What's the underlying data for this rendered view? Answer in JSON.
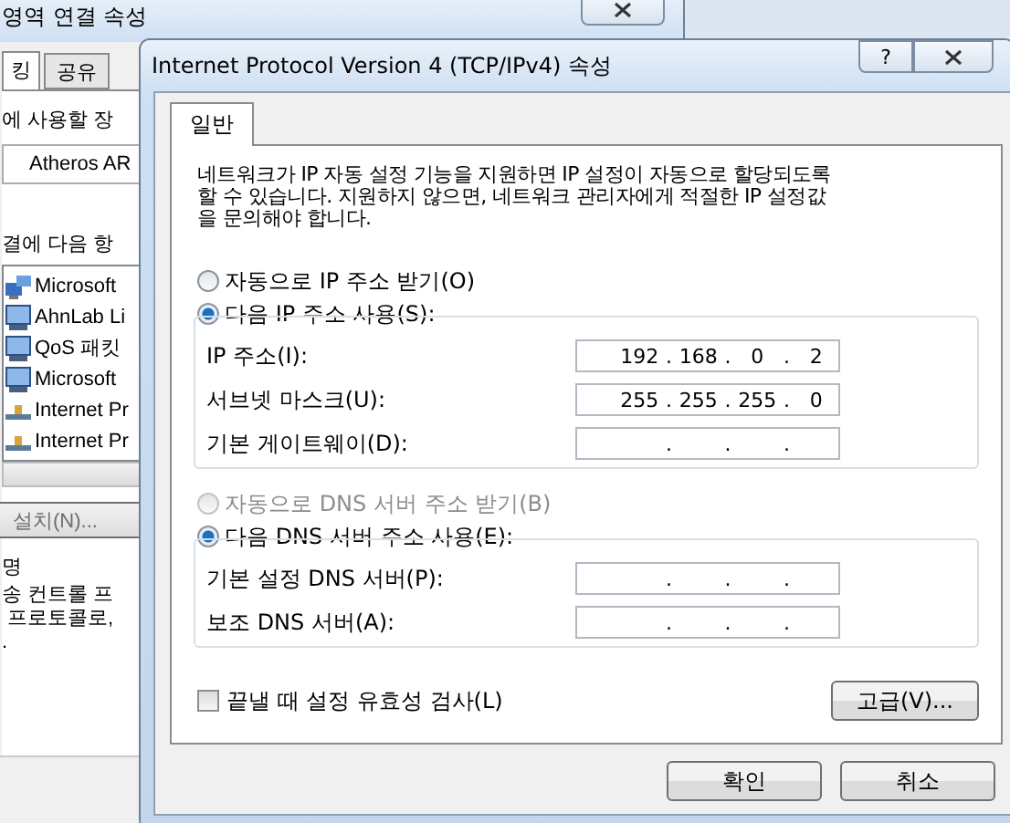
{
  "background_window": {
    "title": "영역 연결 속성",
    "tabs": [
      {
        "label": "킹",
        "selected": true
      },
      {
        "label": "공유",
        "selected": false
      }
    ],
    "connect_label": "에 사용할 장",
    "device_field": {
      "value": "Atheros AR"
    },
    "items_label": "결에 다음 항",
    "items": [
      {
        "label": "Microsoft",
        "kind": "network"
      },
      {
        "label": "AhnLab Li",
        "kind": "computer"
      },
      {
        "label": "QoS 패킷",
        "kind": "computer"
      },
      {
        "label": "Microsoft",
        "kind": "computer"
      },
      {
        "label": "Internet Pr",
        "kind": "protocol"
      },
      {
        "label": "Internet Pr",
        "kind": "protocol"
      }
    ],
    "install_button": "설치(N)...",
    "description_label": "명",
    "description": "송 컨트롤 프\n 프로토콜로,\n."
  },
  "dialog": {
    "title": "Internet Protocol Version 4 (TCP/IPv4) 속성",
    "help_button": "?",
    "tabs": [
      {
        "label": "일반",
        "selected": true
      }
    ],
    "intro": "네트워크가 IP 자동 설정 기능을 지원하면 IP 설정이 자동으로 할당되도록\n할 수 있습니다. 지원하지 않으면, 네트워크 관리자에게 적절한 IP 설정값\n을 문의해야 합니다.",
    "octet_separator": ".",
    "ip_options": [
      {
        "label": "자동으로 IP 주소 받기(O)",
        "selected": false,
        "disabled": false
      },
      {
        "label": "다음 IP 주소 사용(S):",
        "selected": true,
        "disabled": false
      }
    ],
    "ip_fields": [
      {
        "label": "IP 주소(I):",
        "octets": [
          "192",
          "168",
          "0",
          "2"
        ]
      },
      {
        "label": "서브넷 마스크(U):",
        "octets": [
          "255",
          "255",
          "255",
          "0"
        ]
      },
      {
        "label": "기본 게이트웨이(D):"
      }
    ],
    "dns_options": [
      {
        "label": "자동으로 DNS 서버 주소 받기(B)",
        "selected": false,
        "disabled": true
      },
      {
        "label": "다음 DNS 서버 주소 사용(E):",
        "selected": true,
        "disabled": false
      }
    ],
    "dns_fields": [
      {
        "label": "기본 설정 DNS 서버(P):"
      },
      {
        "label": "보조 DNS 서버(A):"
      }
    ],
    "validate_checkbox": {
      "label": "끝낼 때 설정 유효성 검사(L)",
      "checked": false
    },
    "advanced_button": "고급(V)...",
    "ok_button": "확인",
    "cancel_button": "취소"
  }
}
